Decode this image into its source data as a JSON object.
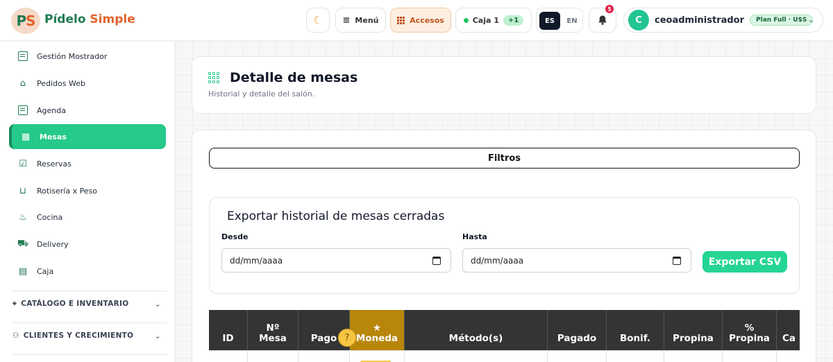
{
  "brand": {
    "logo_text_p": "P",
    "logo_text_s": "S",
    "name_part1": "Pídelo",
    "name_part2": "Simple"
  },
  "header": {
    "theme_icon": "moon-icon",
    "menu_label": "Menú",
    "accesos_label": "Accesos",
    "caja_label": "Caja 1",
    "caja_badge": "+1",
    "lang_es": "ES",
    "lang_en": "EN",
    "notifications_count": "5",
    "user_initial": "C",
    "user_name": "ceoadministrador",
    "plan_label": "Plan Full · U$S"
  },
  "sidebar": {
    "items": [
      {
        "label": "Gestión Mostrador",
        "icon": "register-icon"
      },
      {
        "label": "Pedidos Web",
        "icon": "basket-icon"
      },
      {
        "label": "Agenda",
        "icon": "notebook-icon"
      },
      {
        "label": "Mesas",
        "icon": "grid-icon",
        "active": true
      },
      {
        "label": "Reservas",
        "icon": "calendar-check-icon"
      },
      {
        "label": "Rotisería x Peso",
        "icon": "shopping-basket-icon"
      },
      {
        "label": "Cocina",
        "icon": "flame-icon"
      },
      {
        "label": "Delivery",
        "icon": "truck-icon"
      },
      {
        "label": "Caja",
        "icon": "cash-box-icon"
      }
    ],
    "sections": [
      {
        "label": "CATÁLOGO E INVENTARIO",
        "icon": "tag-icon"
      },
      {
        "label": "CLIENTES Y CRECIMIENTO",
        "icon": "users-icon"
      }
    ]
  },
  "page": {
    "title": "Detalle de mesas",
    "subtitle": "Historial y detalle del salón."
  },
  "filters": {
    "toggle_label": "Filtros"
  },
  "export": {
    "title": "Exportar historial de mesas cerradas",
    "from_label": "Desde",
    "to_label": "Hasta",
    "from_placeholder": "dd/mm/aaaa",
    "to_placeholder": "dd/mm/aaaa",
    "button_label": "Exportar CSV"
  },
  "table": {
    "columns": [
      "ID",
      "Nº\nMesa",
      "Pago",
      "★\nMoneda",
      "Método(s)",
      "Pagado",
      "Bonif.",
      "Propina",
      "%\nPropina",
      "Ca"
    ]
  },
  "colors": {
    "accent": "#25c989",
    "brand_green": "#1f7a4f",
    "brand_orange": "#e2622b",
    "header_dark": "#333535",
    "highlight_col": "#b8860b"
  }
}
